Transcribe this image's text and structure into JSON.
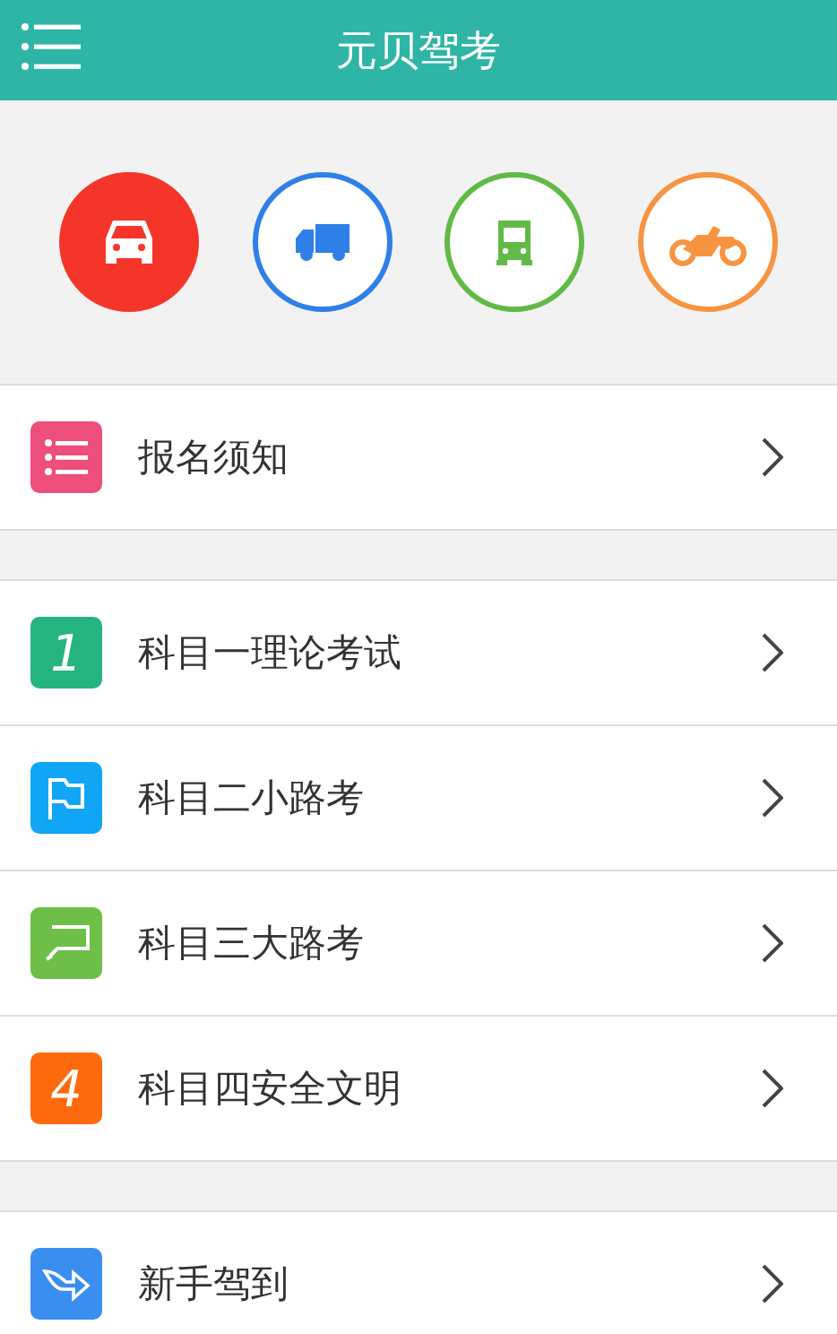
{
  "header": {
    "title": "元贝驾考"
  },
  "vehicles": [
    {
      "kind": "car",
      "color": "#f5352a",
      "selected": true
    },
    {
      "kind": "truck",
      "color": "#2f7fe8",
      "selected": false
    },
    {
      "kind": "bus",
      "color": "#62b946",
      "selected": false
    },
    {
      "kind": "motorcycle",
      "color": "#f79442",
      "selected": false
    }
  ],
  "groups": [
    {
      "items": [
        {
          "label": "报名须知",
          "kind": "list",
          "color": "#ee4e7a"
        }
      ]
    },
    {
      "items": [
        {
          "label": "科目一理论考试",
          "kind": "digit",
          "glyph": "1",
          "color": "#25b480"
        },
        {
          "label": "科目二小路考",
          "kind": "flag",
          "color": "#10a6f5"
        },
        {
          "label": "科目三大路考",
          "kind": "sign",
          "color": "#6dbf47"
        },
        {
          "label": "科目四安全文明",
          "kind": "digit",
          "glyph": "4",
          "color": "#ff6a0e"
        }
      ]
    },
    {
      "items": [
        {
          "label": "新手驾到",
          "kind": "arrow",
          "color": "#3a8ef0"
        }
      ]
    }
  ]
}
